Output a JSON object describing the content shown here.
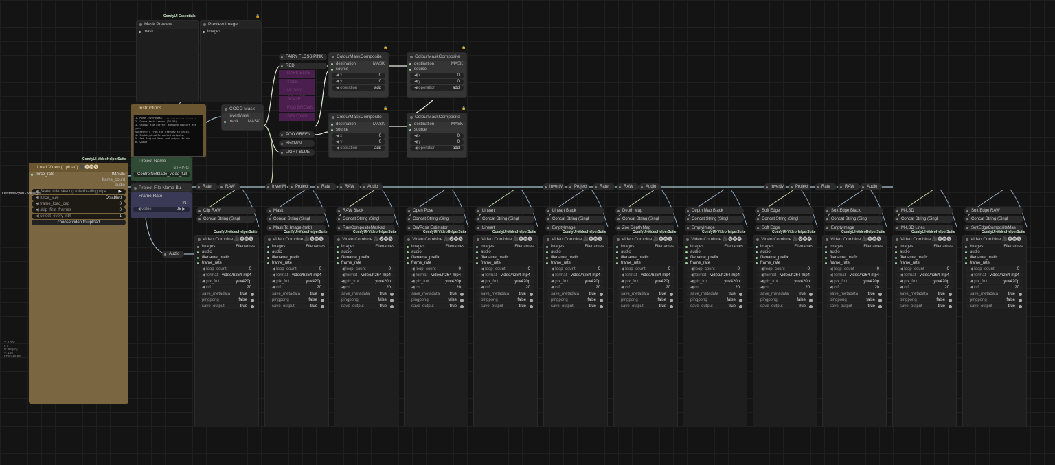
{
  "badges": {
    "essentials": "ComfyUI Essentials",
    "vhs": "ComfyUI-VideoHelperSuite"
  },
  "mask_preview": {
    "title": "Mask Preview",
    "input": "mask"
  },
  "preview_image": {
    "title": "Preview Image",
    "input": "images"
  },
  "instructions": {
    "title": "Instructions",
    "text": "1. Mute InvertMask. ---------------------\n2. Queue test frames (30-50).\n3. Choose the correct masking colours for your\nsubject(s) from the preview to check.\n4. Enable/disable wanted outputs.\n5. Set Project Name and output folder.\n6. Queue."
  },
  "coco": {
    "title": "COCO Mask",
    "invert": "InvertMask",
    "mask_in": "mask",
    "mask_out": "MASK"
  },
  "colors": {
    "active": [
      "FAIRY FLOSS PINK",
      "RED"
    ],
    "muted": [
      "DARK BLUE",
      "YOLK",
      "MUSKY ORANGE",
      "SCALE",
      "POO BROWN",
      "SEA CYAN"
    ],
    "bottom": [
      "POO GREEN",
      "BROWN",
      "LIGHT BLUE"
    ]
  },
  "composite": {
    "title": "ColourMaskComposite",
    "destination": "destination",
    "source": "source",
    "out": "MASK",
    "x_label": "x",
    "y_label": "y",
    "x": "0",
    "y": "0",
    "operation_label": "operation",
    "operation": "add"
  },
  "load_video": {
    "title": "Load Video (Upload) 🎥🅥🅗🅢",
    "outputs": [
      "IMAGE",
      "frame_count",
      "audio"
    ],
    "force_rate": "force_rate",
    "video": "Skate rollerskating rollerblading.mp4",
    "side_label": "Desmtle2you - Wenight",
    "widgets": [
      {
        "label": "force_size",
        "value": "Disabled"
      },
      {
        "label": "frame_load_cap",
        "value": "0"
      },
      {
        "label": "skip_first_frames",
        "value": "0"
      },
      {
        "label": "select_every_nth",
        "value": "1"
      }
    ],
    "upload": "choose video to upload"
  },
  "project_name": {
    "title": "Project Name",
    "out": "STRING",
    "value": "ControlNetblade_video_full"
  },
  "project_file": {
    "title": "Project File Name Bu"
  },
  "frame_rate": {
    "title": "Frame Rate",
    "out": "INT",
    "label": "value",
    "value": "25"
  },
  "audio_reroute": "Audio",
  "reroutes": {
    "rate": "Rate",
    "raw": "RAW",
    "invertm": "InvertM",
    "project": "Project",
    "audio": "Audio"
  },
  "columns": [
    {
      "top": "Clip RAW",
      "mid": "Concat String (Singl",
      "mid2": ""
    },
    {
      "top": "Mask",
      "mid": "Concat String (Singl",
      "mid2": "Mask To Image (mtb)"
    },
    {
      "top": "RAW Black",
      "mid": "Concat String (Singl",
      "mid2": "RawCompositeMasked"
    },
    {
      "top": "Open Pose",
      "mid": "Concat String (Singl",
      "mid2": "DWPose Estimator"
    },
    {
      "top": "Lineart",
      "mid": "Concat String (Singl",
      "mid2": "Lineart"
    },
    {
      "top": "Lineart Black",
      "mid": "Concat String (Singl",
      "mid2": "EmptyImage",
      "mid3": "LineartCompositeMask"
    },
    {
      "top": "Depth Map",
      "mid": "Concat String (Singl",
      "mid2": "Zoe Depth Map"
    },
    {
      "top": "Depth Map Black",
      "mid": "Concat String (Singl",
      "mid2": "EmptyImage",
      "mid3": "DepthCompositeMasked"
    },
    {
      "top": "Soft Edge",
      "mid": "Concat String (Singl",
      "mid2": "Soft Edge"
    },
    {
      "top": "Soft Edge Black",
      "mid": "Concat String (Singl",
      "mid2": "EmptyImage",
      "mid3": "SoftEdgeCompositeMas"
    },
    {
      "top": "M-LSD",
      "mid": "Concat String (Singl",
      "mid2": "M-LSD Lines"
    },
    {
      "top": "Soft Edge RAW",
      "mid": "Concat String (Singl",
      "mid2": "SoftEdgeCompositeMas"
    }
  ],
  "video_combine": {
    "title": "Video Combine 🎥🅥🅗🅢",
    "inputs": [
      "images",
      "audio",
      "filename_prefix",
      "frame_rate"
    ],
    "out": "Filenames",
    "widgets": [
      {
        "label": "loop_count",
        "value": "0"
      },
      {
        "label": "format",
        "value": "video/h264-mp4"
      },
      {
        "label": "pix_fmt",
        "value": "yuv420p"
      },
      {
        "label": "crf",
        "value": "20"
      }
    ],
    "toggles": [
      {
        "label": "save_metadata",
        "value": "true"
      },
      {
        "label": "pingpong",
        "value": "false"
      },
      {
        "label": "save_output",
        "value": "true"
      }
    ]
  },
  "stats": [
    "T: 0.00s",
    "I: 0",
    "N: 93 [93]",
    "V: 185",
    "FPS:120.00"
  ]
}
